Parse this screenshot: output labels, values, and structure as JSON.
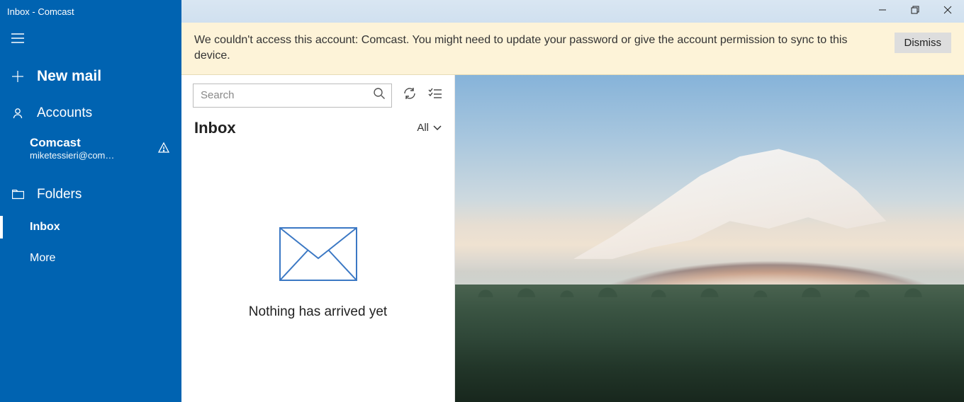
{
  "window": {
    "title": "Inbox - Comcast"
  },
  "sidebar": {
    "new_mail": "New mail",
    "accounts_label": "Accounts",
    "account": {
      "name": "Comcast",
      "address": "miketessieri@com…"
    },
    "folders_label": "Folders",
    "folders": [
      {
        "label": "Inbox",
        "selected": true
      },
      {
        "label": "More",
        "selected": false
      }
    ]
  },
  "banner": {
    "message": "We couldn't access this account: Comcast. You might need to update your password or give the account permission to sync to this device.",
    "dismiss": "Dismiss"
  },
  "search": {
    "placeholder": "Search"
  },
  "list": {
    "title": "Inbox",
    "filter": "All",
    "empty_text": "Nothing has arrived yet"
  }
}
